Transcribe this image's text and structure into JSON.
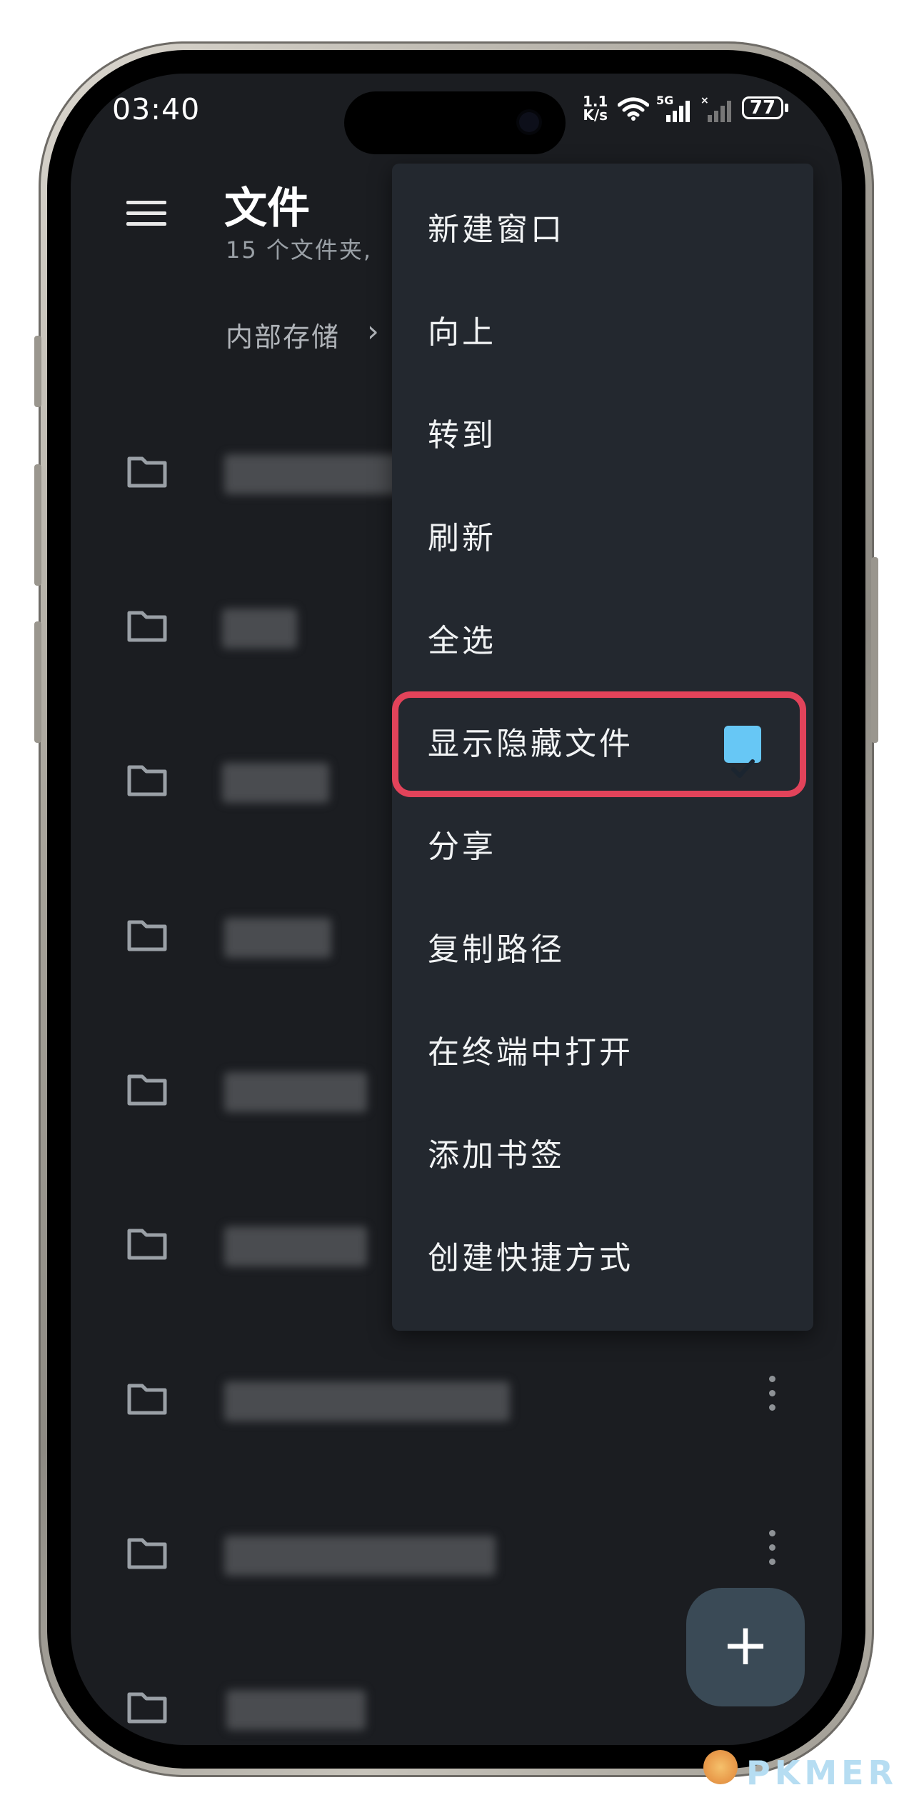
{
  "status_bar": {
    "time": "03:40",
    "net_speed_value": "1.1",
    "net_speed_unit": "K/s",
    "network": "5G",
    "battery": "77"
  },
  "header": {
    "title": "文件",
    "subtitle": "15 个文件夹,",
    "breadcrumb": "内部存储",
    "breadcrumb_separator": "›"
  },
  "overflow_menu": {
    "items": [
      {
        "label": "新建窗口"
      },
      {
        "label": "向上"
      },
      {
        "label": "转到"
      },
      {
        "label": "刷新"
      },
      {
        "label": "全选"
      },
      {
        "label": "显示隐藏文件",
        "checked": true
      },
      {
        "label": "分享"
      },
      {
        "label": "复制路径"
      },
      {
        "label": "在终端中打开"
      },
      {
        "label": "添加书签"
      },
      {
        "label": "创建快捷方式"
      }
    ]
  },
  "folders_visible": 9,
  "fab_label": "+",
  "colors": {
    "background": "#1b1d21",
    "menu_background": "#23282f",
    "checkbox": "#67c7f5",
    "highlight": "#e2435a"
  },
  "watermark": "PKMER"
}
